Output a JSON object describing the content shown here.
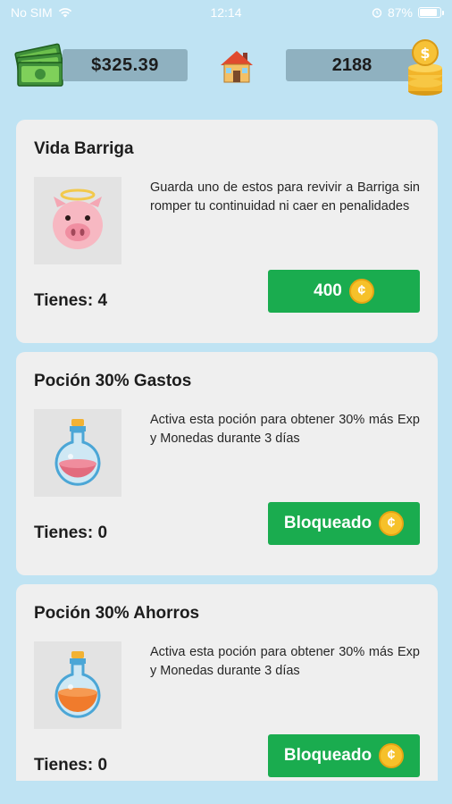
{
  "status_bar": {
    "carrier": "No SIM",
    "time": "12:14",
    "battery": "87%"
  },
  "header": {
    "money": "$325.39",
    "coins": "2188",
    "icons": {
      "money": "money-icon",
      "home": "home-icon",
      "coins": "coins-icon"
    }
  },
  "items": [
    {
      "title": "Vida Barriga",
      "description": "Guarda uno de estos para revivir a Barriga sin romper tu continuidad ni caer en penalidades",
      "count": "Tienes: 4",
      "button": "400",
      "image": "pig-angel-icon"
    },
    {
      "title": "Poción 30% Gastos",
      "description": "Activa esta poción para obtener 30% más Exp y Monedas durante 3 días",
      "count": "Tienes: 0",
      "button": "Bloqueado",
      "image": "pink-potion-icon"
    },
    {
      "title": "Poción 30% Ahorros",
      "description": "Activa esta poción para obtener 30% más Exp y Monedas durante 3 días",
      "count": "Tienes: 0",
      "button": "Bloqueado",
      "image": "orange-potion-icon"
    }
  ],
  "colors": {
    "background": "#bfe3f3",
    "card": "#efefef",
    "button": "#1aac4f",
    "coin": "#f6c12a"
  }
}
